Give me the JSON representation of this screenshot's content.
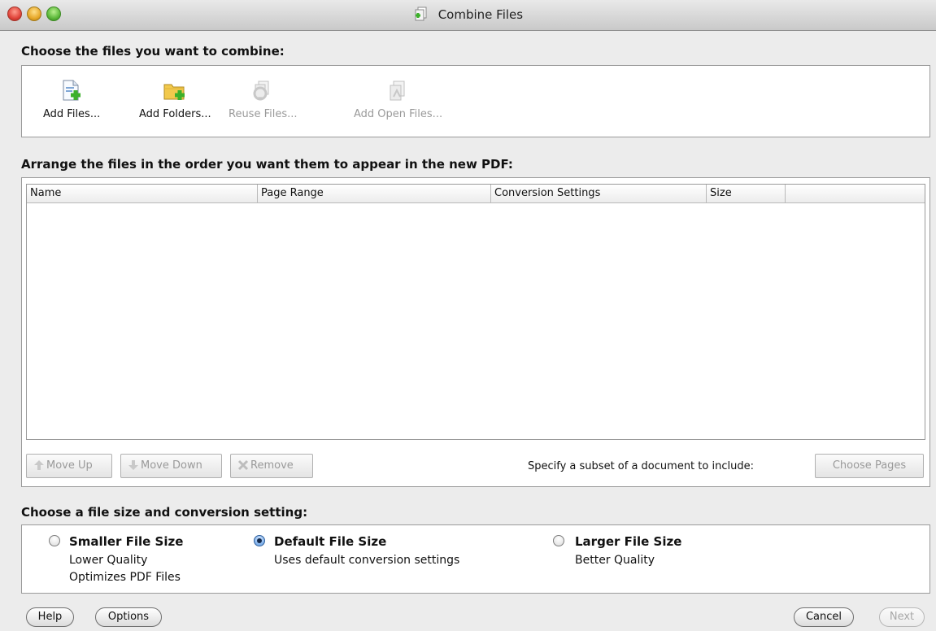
{
  "window": {
    "title": "Combine Files"
  },
  "sections": {
    "choose_files": "Choose the files you want to combine:",
    "arrange_files": "Arrange the files in the order you want them to appear in the new PDF:",
    "file_size": "Choose a file size and conversion setting:"
  },
  "toolbar": {
    "add_files": "Add Files...",
    "add_folders": "Add Folders...",
    "reuse_files": "Reuse Files...",
    "add_open_files": "Add Open Files..."
  },
  "table": {
    "columns": [
      "Name",
      "Page Range",
      "Conversion Settings",
      "Size",
      ""
    ],
    "rows": []
  },
  "list_actions": {
    "move_up": "Move Up",
    "move_down": "Move Down",
    "remove": "Remove",
    "subset_hint": "Specify a subset of a document to include:",
    "choose_pages": "Choose Pages"
  },
  "size_options": [
    {
      "title": "Smaller File Size",
      "lines": [
        "Lower Quality",
        "Optimizes PDF Files"
      ],
      "selected": false
    },
    {
      "title": "Default File Size",
      "lines": [
        "Uses default conversion settings"
      ],
      "selected": true
    },
    {
      "title": "Larger File Size",
      "lines": [
        "Better Quality"
      ],
      "selected": false
    }
  ],
  "footer": {
    "help": "Help",
    "options": "Options",
    "cancel": "Cancel",
    "next": "Next"
  },
  "colors": {
    "window_bg": "#ececec",
    "disabled_text": "#9a9a9a",
    "add_icon_green": "#3cb02a",
    "folder_yellow": "#f2c94c"
  },
  "icons": {
    "add_files": "document-add-icon",
    "add_folders": "folder-add-icon",
    "reuse_files": "reuse-files-icon",
    "add_open_files": "open-files-icon",
    "move_up": "arrow-up-icon",
    "move_down": "arrow-down-icon",
    "remove": "remove-x-icon"
  }
}
